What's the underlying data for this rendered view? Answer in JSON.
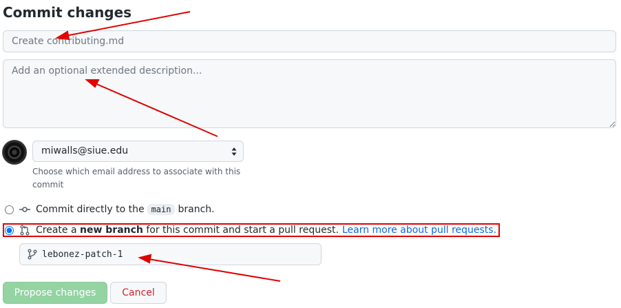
{
  "heading": "Commit changes",
  "summary": {
    "placeholder": "Create contributing.md"
  },
  "description": {
    "placeholder": "Add an optional extended description..."
  },
  "author": {
    "email": "miwalls@siue.edu",
    "note": "Choose which email address to associate with this commit"
  },
  "options": {
    "direct": {
      "prefix": "Commit directly to the",
      "branch": "main",
      "suffix": "branch."
    },
    "new_branch": {
      "prefix": "Create a",
      "bold": "new branch",
      "suffix": "for this commit and start a pull request.",
      "link": "Learn more about pull requests."
    }
  },
  "branch_name": "lebonez-patch-1",
  "buttons": {
    "propose": "Propose changes",
    "cancel": "Cancel"
  },
  "colors": {
    "accent": "#0969da",
    "annotation": "#e00000",
    "propose_disabled": "#94d3a2",
    "cancel_text": "#cf222e"
  },
  "icons": [
    "git-commit-icon",
    "git-pull-request-icon",
    "git-branch-icon",
    "select-arrows-icon"
  ]
}
